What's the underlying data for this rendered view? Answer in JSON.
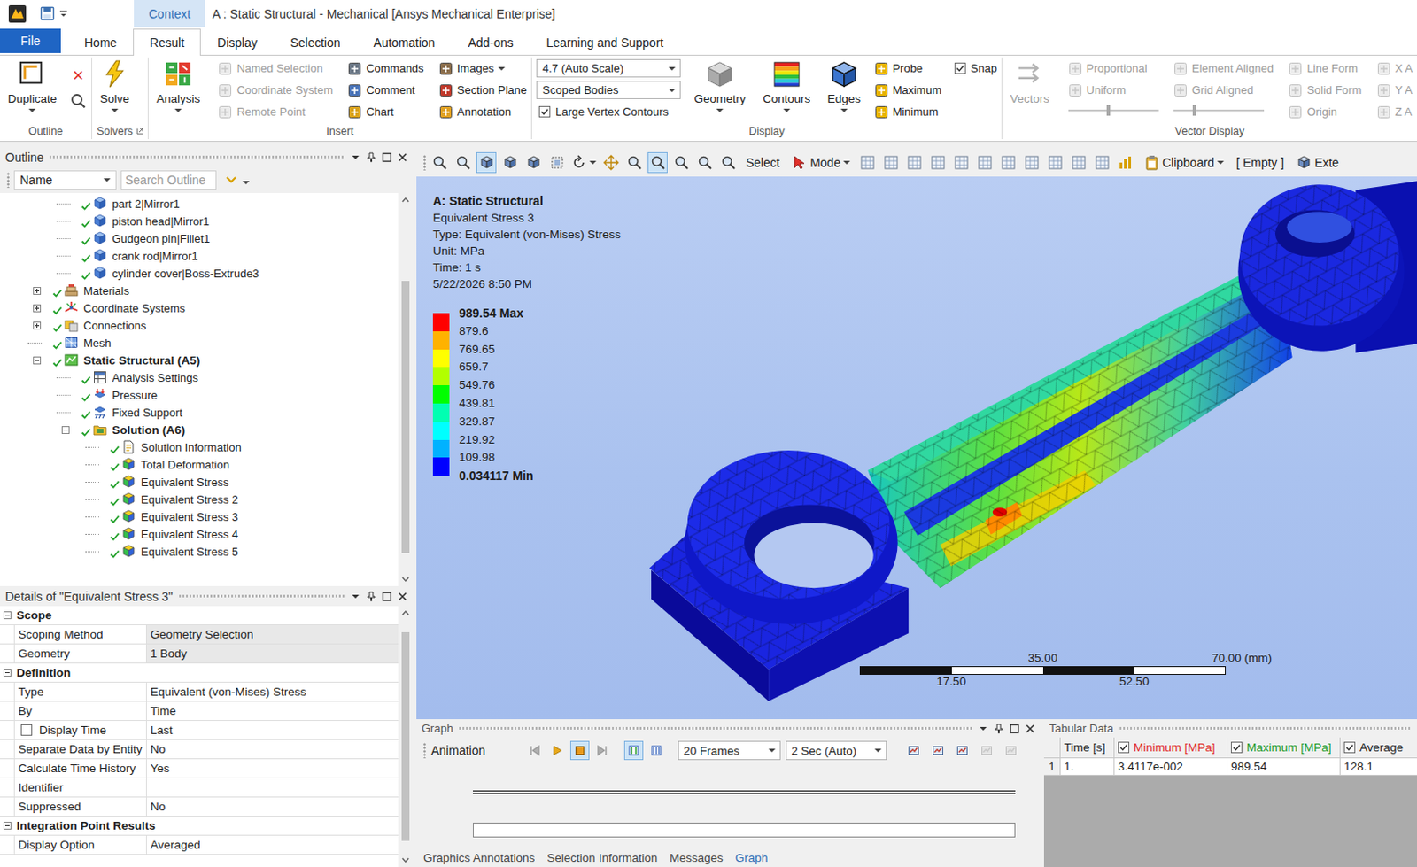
{
  "window": {
    "title": "A : Static Structural - Mechanical [Ansys Mechanical Enterprise]",
    "context_tab": "Context"
  },
  "menu_tabs": [
    {
      "label": "File",
      "kind": "file",
      "selected": false
    },
    {
      "label": "Home",
      "kind": "tab",
      "selected": false
    },
    {
      "label": "Result",
      "kind": "tab",
      "selected": true
    },
    {
      "label": "Display",
      "kind": "tab",
      "selected": false
    },
    {
      "label": "Selection",
      "kind": "tab",
      "selected": false
    },
    {
      "label": "Automation",
      "kind": "tab",
      "selected": false
    },
    {
      "label": "Add-ons",
      "kind": "tab",
      "selected": false
    },
    {
      "label": "Learning and Support",
      "kind": "tab",
      "selected": false
    }
  ],
  "ribbon": [
    {
      "label": "Outline",
      "launcher": false,
      "columns": [
        [
          {
            "kind": "large",
            "label": "Duplicate",
            "dropdown": true,
            "disabled": false
          }
        ],
        [
          {
            "kind": "glyph",
            "label": "×",
            "disabled": false
          },
          {
            "kind": "search",
            "disabled": false
          }
        ]
      ]
    },
    {
      "label": "Solvers",
      "launcher": true,
      "columns": [
        [
          {
            "kind": "large",
            "label": "Solve",
            "dropdown": true,
            "disabled": false
          }
        ]
      ]
    },
    {
      "label": "Insert",
      "launcher": false,
      "columns": [
        [
          {
            "kind": "large",
            "label": "Analysis",
            "dropdown": true,
            "disabled": false
          }
        ],
        [
          {
            "kind": "small",
            "label": "Named Selection",
            "dropdown": false,
            "disabled": true
          },
          {
            "kind": "small",
            "label": "Coordinate System",
            "dropdown": false,
            "disabled": true
          },
          {
            "kind": "small",
            "label": "Remote Point",
            "dropdown": false,
            "disabled": true
          }
        ],
        [
          {
            "kind": "small",
            "label": "Commands",
            "dropdown": false,
            "disabled": false
          },
          {
            "kind": "small",
            "label": "Comment",
            "dropdown": false,
            "disabled": false
          },
          {
            "kind": "small",
            "label": "Chart",
            "dropdown": false,
            "disabled": false
          }
        ],
        [
          {
            "kind": "small",
            "label": "Images",
            "dropdown": true,
            "disabled": false
          },
          {
            "kind": "small",
            "label": "Section Plane",
            "dropdown": false,
            "disabled": false
          },
          {
            "kind": "small",
            "label": "Annotation",
            "dropdown": false,
            "disabled": false
          }
        ]
      ]
    },
    {
      "label": "Display",
      "launcher": false,
      "columns": [
        [
          {
            "kind": "select",
            "label": "4.7 (Auto Scale)",
            "disabled": false
          },
          {
            "kind": "select",
            "label": "Scoped Bodies",
            "disabled": false
          },
          {
            "kind": "check",
            "label": "Large Vertex Contours",
            "checked": true,
            "disabled": false
          }
        ],
        [
          {
            "kind": "large",
            "label": "Geometry",
            "dropdown": true,
            "disabled": false
          }
        ],
        [
          {
            "kind": "large",
            "label": "Contours",
            "dropdown": true,
            "disabled": false
          }
        ],
        [
          {
            "kind": "large",
            "label": "Edges",
            "dropdown": true,
            "disabled": false
          }
        ],
        [
          {
            "kind": "small",
            "label": "Probe",
            "dropdown": false,
            "disabled": false
          },
          {
            "kind": "small",
            "label": "Maximum",
            "dropdown": false,
            "disabled": false
          },
          {
            "kind": "small",
            "label": "Minimum",
            "dropdown": false,
            "disabled": false
          }
        ],
        [
          {
            "kind": "check",
            "label": "Snap",
            "checked": true,
            "disabled": false
          }
        ]
      ]
    },
    {
      "label": "Vector Display",
      "launcher": false,
      "columns": [
        [
          {
            "kind": "large",
            "label": "Vectors",
            "dropdown": false,
            "disabled": true
          }
        ],
        [
          {
            "kind": "small",
            "label": "Proportional",
            "dropdown": false,
            "disabled": true
          },
          {
            "kind": "small",
            "label": "Uniform",
            "dropdown": false,
            "disabled": true
          },
          {
            "kind": "slider",
            "level": 0.45,
            "disabled": true
          }
        ],
        [
          {
            "kind": "small",
            "label": "Element Aligned",
            "dropdown": false,
            "disabled": true
          },
          {
            "kind": "small",
            "label": "Grid Aligned",
            "dropdown": false,
            "disabled": true
          },
          {
            "kind": "slider",
            "level": 0.23,
            "disabled": true
          }
        ],
        [
          {
            "kind": "small",
            "label": "Line Form",
            "dropdown": false,
            "disabled": true
          },
          {
            "kind": "small",
            "label": "Solid Form",
            "dropdown": false,
            "disabled": true
          },
          {
            "kind": "small",
            "label": "Origin",
            "dropdown": false,
            "disabled": true
          }
        ],
        [
          {
            "kind": "small",
            "label": "X A",
            "dropdown": false,
            "disabled": true
          },
          {
            "kind": "small",
            "label": "Y A",
            "dropdown": false,
            "disabled": true
          },
          {
            "kind": "small",
            "label": "Z A",
            "dropdown": false,
            "disabled": true
          }
        ]
      ]
    }
  ],
  "outline": {
    "title": "Outline",
    "filter_field": "Name",
    "search_placeholder": "Search Outline",
    "scroll": {
      "offset": 0.2,
      "size": 0.75
    },
    "tree": [
      {
        "label": "part 2|Mirror1",
        "level": 2,
        "kind": "body",
        "expandable": false,
        "expanded": false,
        "bold": false
      },
      {
        "label": "piston head|Mirror1",
        "level": 2,
        "kind": "body",
        "expandable": false,
        "expanded": false,
        "bold": false
      },
      {
        "label": "Gudgeon pin|Fillet1",
        "level": 2,
        "kind": "body",
        "expandable": false,
        "expanded": false,
        "bold": false
      },
      {
        "label": "crank rod|Mirror1",
        "level": 2,
        "kind": "body",
        "expandable": false,
        "expanded": false,
        "bold": false
      },
      {
        "label": "cylinder cover|Boss-Extrude3",
        "level": 2,
        "kind": "body",
        "expandable": false,
        "expanded": false,
        "bold": false
      },
      {
        "label": "Materials",
        "level": 1,
        "kind": "materials",
        "expandable": true,
        "expanded": false,
        "bold": false
      },
      {
        "label": "Coordinate Systems",
        "level": 1,
        "kind": "coords",
        "expandable": true,
        "expanded": false,
        "bold": false
      },
      {
        "label": "Connections",
        "level": 1,
        "kind": "connections",
        "expandable": true,
        "expanded": false,
        "bold": false
      },
      {
        "label": "Mesh",
        "level": 1,
        "kind": "mesh",
        "expandable": false,
        "expanded": false,
        "bold": false
      },
      {
        "label": "Static Structural (A5)",
        "level": 1,
        "kind": "analysis",
        "expandable": true,
        "expanded": true,
        "bold": true
      },
      {
        "label": "Analysis Settings",
        "level": 2,
        "kind": "settings",
        "expandable": false,
        "expanded": false,
        "bold": false
      },
      {
        "label": "Pressure",
        "level": 2,
        "kind": "pressure",
        "expandable": false,
        "expanded": false,
        "bold": false
      },
      {
        "label": "Fixed Support",
        "level": 2,
        "kind": "support",
        "expandable": false,
        "expanded": false,
        "bold": false
      },
      {
        "label": "Solution (A6)",
        "level": 2,
        "kind": "solution",
        "expandable": true,
        "expanded": true,
        "bold": true
      },
      {
        "label": "Solution Information",
        "level": 3,
        "kind": "info",
        "expandable": false,
        "expanded": false,
        "bold": false
      },
      {
        "label": "Total Deformation",
        "level": 3,
        "kind": "result",
        "expandable": false,
        "expanded": false,
        "bold": false
      },
      {
        "label": "Equivalent Stress",
        "level": 3,
        "kind": "result",
        "expandable": false,
        "expanded": false,
        "bold": false
      },
      {
        "label": "Equivalent Stress 2",
        "level": 3,
        "kind": "result",
        "expandable": false,
        "expanded": false,
        "bold": false
      },
      {
        "label": "Equivalent Stress 3",
        "level": 3,
        "kind": "result",
        "expandable": false,
        "expanded": false,
        "bold": false
      },
      {
        "label": "Equivalent Stress 4",
        "level": 3,
        "kind": "result",
        "expandable": false,
        "expanded": false,
        "bold": false
      },
      {
        "label": "Equivalent Stress 5",
        "level": 3,
        "kind": "result",
        "expandable": false,
        "expanded": false,
        "bold": false
      }
    ]
  },
  "details": {
    "title": "Details of \"Equivalent Stress 3\"",
    "scroll": {
      "offset": 0.05,
      "size": 0.9
    },
    "rows": [
      {
        "kind": "section",
        "label": "Scope",
        "expanded": true
      },
      {
        "kind": "field",
        "label": "Scoping Method",
        "value": "Geometry Selection",
        "shaded": true
      },
      {
        "kind": "field",
        "label": "Geometry",
        "value": "1 Body",
        "shaded": true
      },
      {
        "kind": "section",
        "label": "Definition",
        "expanded": true
      },
      {
        "kind": "field",
        "label": "Type",
        "value": "Equivalent (von-Mises) Stress",
        "shaded": false
      },
      {
        "kind": "field",
        "label": "By",
        "value": "Time",
        "shaded": false
      },
      {
        "kind": "check-field",
        "label": "Display Time",
        "value": "Last",
        "checked": false,
        "shaded": false
      },
      {
        "kind": "field",
        "label": "Separate Data by Entity",
        "value": "No",
        "shaded": false
      },
      {
        "kind": "field",
        "label": "Calculate Time History",
        "value": "Yes",
        "shaded": false
      },
      {
        "kind": "field",
        "label": "Identifier",
        "value": "",
        "shaded": false
      },
      {
        "kind": "field",
        "label": "Suppressed",
        "value": "No",
        "shaded": false
      },
      {
        "kind": "section",
        "label": "Integration Point Results",
        "expanded": true
      },
      {
        "kind": "field",
        "label": "Display Option",
        "value": "Averaged",
        "shaded": false
      }
    ]
  },
  "graphics_toolbar": [
    {
      "kind": "icon",
      "selected": false,
      "dropdown": false
    },
    {
      "kind": "icon",
      "selected": false,
      "dropdown": false
    },
    {
      "kind": "icon",
      "selected": true,
      "dropdown": false
    },
    {
      "kind": "icon",
      "selected": false,
      "dropdown": false
    },
    {
      "kind": "icon",
      "selected": false,
      "dropdown": false
    },
    {
      "kind": "icon",
      "selected": false,
      "dropdown": false
    },
    {
      "kind": "icon",
      "selected": false,
      "dropdown": true
    },
    {
      "kind": "icon",
      "selected": false,
      "dropdown": false
    },
    {
      "kind": "icon",
      "selected": false,
      "dropdown": false
    },
    {
      "kind": "icon",
      "selected": true,
      "dropdown": false
    },
    {
      "kind": "icon",
      "selected": false,
      "dropdown": false
    },
    {
      "kind": "icon",
      "selected": false,
      "dropdown": false
    },
    {
      "kind": "icon",
      "selected": false,
      "dropdown": false
    },
    {
      "kind": "text",
      "label": "Select",
      "selected": false,
      "dropdown": false
    },
    {
      "kind": "icon-text",
      "label": "Mode",
      "selected": false,
      "dropdown": true
    },
    {
      "kind": "icon",
      "selected": false,
      "dropdown": false
    },
    {
      "kind": "icon",
      "selected": false,
      "dropdown": false
    },
    {
      "kind": "icon",
      "selected": false,
      "dropdown": false
    },
    {
      "kind": "icon",
      "selected": false,
      "dropdown": false
    },
    {
      "kind": "icon",
      "selected": false,
      "dropdown": false
    },
    {
      "kind": "icon",
      "selected": false,
      "dropdown": false
    },
    {
      "kind": "icon",
      "selected": false,
      "dropdown": false
    },
    {
      "kind": "icon",
      "selected": false,
      "dropdown": false
    },
    {
      "kind": "icon",
      "selected": false,
      "dropdown": false
    },
    {
      "kind": "icon",
      "selected": false,
      "dropdown": false
    },
    {
      "kind": "icon",
      "selected": false,
      "dropdown": false
    },
    {
      "kind": "icon",
      "selected": false,
      "dropdown": false
    },
    {
      "kind": "icon-text",
      "label": "Clipboard",
      "selected": false,
      "dropdown": true
    },
    {
      "kind": "text",
      "label": "[ Empty ]",
      "selected": false,
      "dropdown": false
    },
    {
      "kind": "icon-text",
      "label": "Exte",
      "selected": false,
      "dropdown": false
    }
  ],
  "viewport": {
    "info": [
      {
        "text": "A: Static Structural",
        "bold": true
      },
      {
        "text": "Equivalent Stress 3",
        "bold": false
      },
      {
        "text": "Type: Equivalent (von-Mises) Stress",
        "bold": false
      },
      {
        "text": "Unit: MPa",
        "bold": false
      },
      {
        "text": "Time: 1 s",
        "bold": false
      },
      {
        "text": "5/22/2026 8:50 PM",
        "bold": false
      }
    ],
    "legend": {
      "labels": [
        {
          "text": "989.54 Max",
          "bold": true
        },
        {
          "text": "879.6",
          "bold": false
        },
        {
          "text": "769.65",
          "bold": false
        },
        {
          "text": "659.7",
          "bold": false
        },
        {
          "text": "549.76",
          "bold": false
        },
        {
          "text": "439.81",
          "bold": false
        },
        {
          "text": "329.87",
          "bold": false
        },
        {
          "text": "219.92",
          "bold": false
        },
        {
          "text": "109.98",
          "bold": false
        },
        {
          "text": "0.034117 Min",
          "bold": true
        }
      ],
      "bands": [
        {
          "color": "#ff0000"
        },
        {
          "color": "#ffb200"
        },
        {
          "color": "#ffff00"
        },
        {
          "color": "#b2ff00"
        },
        {
          "color": "#00ff00"
        },
        {
          "color": "#00ffb2"
        },
        {
          "color": "#00ffff"
        },
        {
          "color": "#00b2ff"
        },
        {
          "color": "#0000ff"
        }
      ]
    },
    "scale": {
      "top": [
        "35.00",
        "70.00 (mm)"
      ],
      "bottom": [
        "17.50",
        "52.50"
      ]
    }
  },
  "graph": {
    "title": "Graph",
    "animation_label": "Animation",
    "frames": "20 Frames",
    "duration": "2 Sec (Auto)",
    "controls": [
      {
        "kind": "first",
        "selected": false
      },
      {
        "kind": "play",
        "selected": false
      },
      {
        "kind": "stop",
        "selected": true
      },
      {
        "kind": "last",
        "selected": false
      }
    ],
    "views": [
      {
        "kind": "distributed",
        "selected": true
      },
      {
        "kind": "result-sets",
        "selected": false
      }
    ],
    "tools": [
      {
        "disabled": false
      },
      {
        "disabled": false
      },
      {
        "disabled": false
      },
      {
        "disabled": true
      },
      {
        "disabled": true
      }
    ],
    "tabs": [
      {
        "label": "Graphics Annotations",
        "selected": false
      },
      {
        "label": "Selection Information",
        "selected": false
      },
      {
        "label": "Messages",
        "selected": false
      },
      {
        "label": "Graph",
        "selected": true
      }
    ]
  },
  "tabular": {
    "title": "Tabular Data",
    "columns": [
      {
        "label": "Time [s]",
        "kind": "plain",
        "checked": false,
        "color": "#1e1e1e"
      },
      {
        "label": "Minimum [MPa]",
        "kind": "check",
        "checked": true,
        "color": "#e02a2a"
      },
      {
        "label": "Maximum [MPa]",
        "kind": "check",
        "checked": true,
        "color": "#1a9a2a"
      },
      {
        "label": "Average",
        "kind": "check",
        "checked": true,
        "color": "#1e1e1e"
      }
    ],
    "rows": [
      {
        "index": "1",
        "cells": [
          "1.",
          "3.4117e-002",
          "989.54",
          "128.1"
        ]
      }
    ]
  }
}
